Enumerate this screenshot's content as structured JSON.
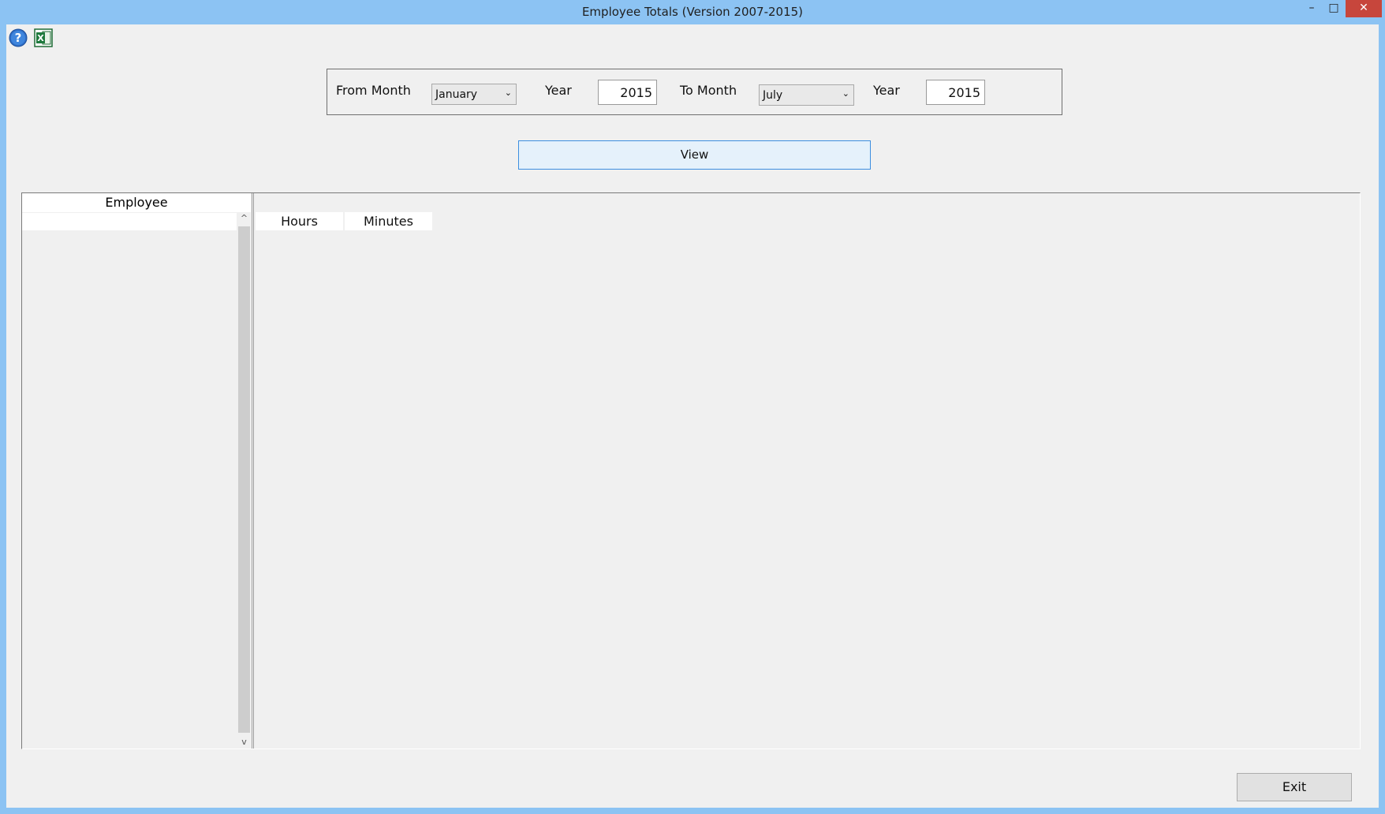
{
  "window": {
    "title": "Employee Totals (Version 2007-2015)",
    "minimize": "–",
    "maximize": "□",
    "close": "✕"
  },
  "toolbar": {
    "icons": [
      "help-icon",
      "excel-icon"
    ]
  },
  "filter": {
    "from_month_label": "From Month",
    "from_month_value": "January",
    "from_year_label": "Year",
    "from_year_value": "2015",
    "to_month_label": "To Month",
    "to_month_value": "July",
    "to_year_label": "Year",
    "to_year_value": "2015",
    "dropdown_arrow": "⌄"
  },
  "view_button": "View",
  "grid": {
    "employee_header": "Employee",
    "columns": [
      "Hours",
      "Minutes"
    ],
    "scroll_up": "^",
    "scroll_down": "v"
  },
  "exit_button": "Exit",
  "colors": {
    "titlebar": "#8cc3f3",
    "close": "#c7463c",
    "view_button_border": "#3c8ee0"
  }
}
